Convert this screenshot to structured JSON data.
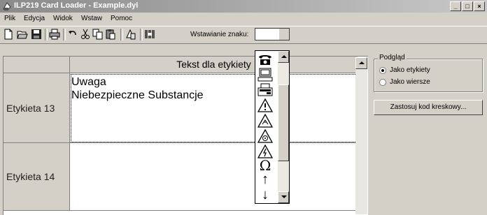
{
  "window": {
    "title": "ILP219 Card Loader - Example.dyl",
    "minimize_glyph": "_",
    "maximize_glyph": "□",
    "close_glyph": "×"
  },
  "menu": {
    "items": [
      {
        "label": "Plik"
      },
      {
        "label": "Edycja"
      },
      {
        "label": "Widok"
      },
      {
        "label": "Wstaw"
      },
      {
        "label": "Pomoc"
      }
    ]
  },
  "toolbar": {
    "icons": [
      "new-document-icon",
      "open-folder-icon",
      "save-icon",
      "print-icon",
      "undo-icon",
      "cut-icon",
      "copy-icon",
      "paste-icon",
      "insert-symbol-icon",
      "barcode-icon"
    ],
    "insert_char_label": "Wstawianie znaku:",
    "insert_char_value": ""
  },
  "grid": {
    "column_header": "Tekst dla etykiety",
    "rows": [
      {
        "label": "Etykieta 13",
        "lines": [
          "Uwaga",
          "Niebezpieczne Substancje"
        ]
      },
      {
        "label": "Etykieta 14",
        "lines": []
      }
    ]
  },
  "symbol_dropdown": {
    "symbols": [
      "telephone-icon",
      "computer-icon",
      "fax-icon",
      "warning-exclamation-icon",
      "warning-biohazard-icon",
      "warning-radiation-icon",
      "warning-high-voltage-icon",
      "omega-symbol",
      "arrow-up-symbol",
      "arrow-down-symbol"
    ],
    "omega": "Ω",
    "arrow_up": "↑",
    "arrow_down": "↓"
  },
  "preview": {
    "legend": "Podgląd",
    "options": [
      {
        "label": "Jako etykiety",
        "selected": true
      },
      {
        "label": "Jako wiersze",
        "selected": false
      }
    ]
  },
  "barcode_button": {
    "label": "Zastosuj kod kreskowy..."
  },
  "colors": {
    "face": "#d4d0c8",
    "title_start": "#8a8a8a",
    "title_end": "#c8c8c8"
  }
}
